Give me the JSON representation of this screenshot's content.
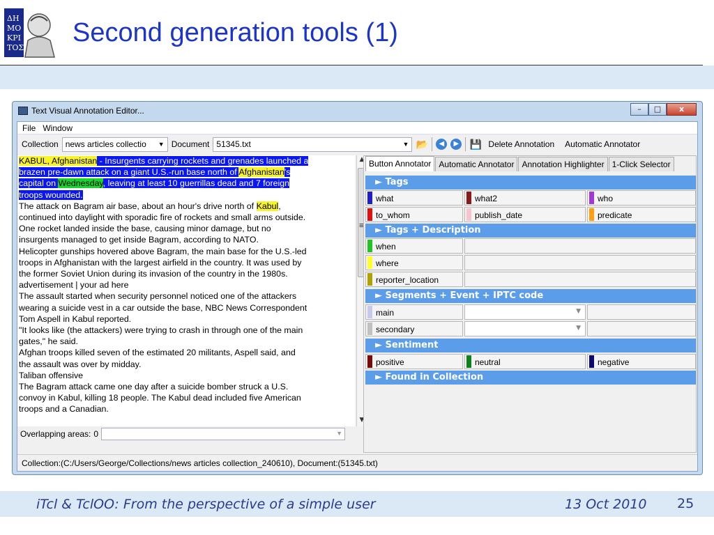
{
  "slide": {
    "title": "Second generation tools (1)",
    "footer_left": "iTcl & TclOO: From the perspective of a simple user",
    "footer_date": "13 Oct 2010",
    "page_number": "25"
  },
  "window": {
    "title": "Text Visual Annotation Editor...",
    "buttons": {
      "minimize": "–",
      "maximize": "□",
      "close": "x"
    }
  },
  "menu": [
    "File",
    "Window"
  ],
  "toolbar": {
    "collection_label": "Collection",
    "collection_value": "news articles collectio",
    "document_label": "Document",
    "document_value": "51345.txt",
    "delete_label": "Delete Annotation",
    "auto_label": "Automatic Annotator"
  },
  "text_lines": [
    [
      {
        "t": "KABUL, Afghanistan",
        "h": "yellow"
      },
      {
        "t": " - ",
        "h": "blue"
      },
      {
        "t": "Insurgents carrying rockets and grenades launched a",
        "h": "blue"
      }
    ],
    [
      {
        "t": "brazen pre-dawn attack on a giant U.S.-run base north of ",
        "h": "blue"
      },
      {
        "t": "Afghanistan",
        "h": "yellow"
      },
      {
        "t": "'s",
        "h": "blue"
      }
    ],
    [
      {
        "t": "capital on ",
        "h": "blue"
      },
      {
        "t": "Wednesday",
        "h": "green"
      },
      {
        "t": ", leaving at least 10 guerrillas dead and 7 foreign",
        "h": "blue"
      }
    ],
    [
      {
        "t": "troops wounded.",
        "h": "blue"
      }
    ],
    [
      {
        "t": "The attack on Bagram air base, about an hour's drive north of "
      },
      {
        "t": "Kabul",
        "h": "yellow"
      },
      {
        "t": ","
      }
    ],
    [
      {
        "t": "continued into daylight with sporadic fire of rockets and small arms outside."
      }
    ],
    [
      {
        "t": "One rocket landed inside the base, causing minor damage, but no"
      }
    ],
    [
      {
        "t": "insurgents managed to get inside Bagram, according to NATO."
      }
    ],
    [
      {
        "t": "Helicopter gunships hovered above Bagram, the main base for the U.S.-led"
      }
    ],
    [
      {
        "t": "troops in Afghanistan with the largest airfield in the country. It was used by"
      }
    ],
    [
      {
        "t": "the former Soviet Union during its invasion of the country in the 1980s."
      }
    ],
    [
      {
        "t": "advertisement | your ad here"
      }
    ],
    [
      {
        "t": "The assault started when security personnel noticed one of the attackers"
      }
    ],
    [
      {
        "t": "wearing a suicide vest in a car outside the base, NBC News Correspondent"
      }
    ],
    [
      {
        "t": "Tom Aspell in Kabul reported."
      }
    ],
    [
      {
        "t": "\"It looks like (the attackers) were trying to crash in through one of the main"
      }
    ],
    [
      {
        "t": "gates,\" he said."
      }
    ],
    [
      {
        "t": "Afghan troops killed seven of the estimated 20 militants, Aspell said, and"
      }
    ],
    [
      {
        "t": "the assault was over by midday."
      }
    ],
    [
      {
        "t": "Taliban offensive"
      }
    ],
    [
      {
        "t": "The Bagram attack came one day after a suicide bomber struck a U.S."
      }
    ],
    [
      {
        "t": "convoy in Kabul, killing 18 people. The Kabul dead included five American"
      }
    ],
    [
      {
        "t": "troops and a Canadian."
      }
    ]
  ],
  "overlap": {
    "label": "Overlapping areas:",
    "value": "0"
  },
  "status": "Collection:(C:/Users/George/Collections/news articles collection_240610), Document:(51345.txt)",
  "tabs": [
    "Button Annotator",
    "Automatic Annotator",
    "Annotation Highlighter",
    "1-Click Selector"
  ],
  "sections": {
    "tags": "►  Tags",
    "tags_desc": "►  Tags + Description",
    "segments": "►  Segments + Event + IPTC code",
    "sentiment": "►  Sentiment",
    "found": "►  Found in Collection"
  },
  "tags": [
    {
      "label": "what",
      "color": "#1f1fc8"
    },
    {
      "label": "what2",
      "color": "#8b1a1a"
    },
    {
      "label": "who",
      "color": "#a43ad6"
    },
    {
      "label": "to_whom",
      "color": "#e01010"
    },
    {
      "label": "publish_date",
      "color": "#f5c4cf"
    },
    {
      "label": "predicate",
      "color": "#ffa010"
    }
  ],
  "tags_desc": [
    {
      "label": "when",
      "color": "#22c322"
    },
    {
      "label": "where",
      "color": "#ffff30"
    },
    {
      "label": "reporter_location",
      "color": "#b0a000"
    }
  ],
  "segments": [
    {
      "label": "main",
      "color": "#c8c8ee"
    },
    {
      "label": "secondary",
      "color": "#c0c0c0"
    }
  ],
  "sentiment": [
    {
      "label": "positive",
      "color": "#7a0a0a"
    },
    {
      "label": "neutral",
      "color": "#10801a"
    },
    {
      "label": "negative",
      "color": "#0a0a70"
    }
  ]
}
